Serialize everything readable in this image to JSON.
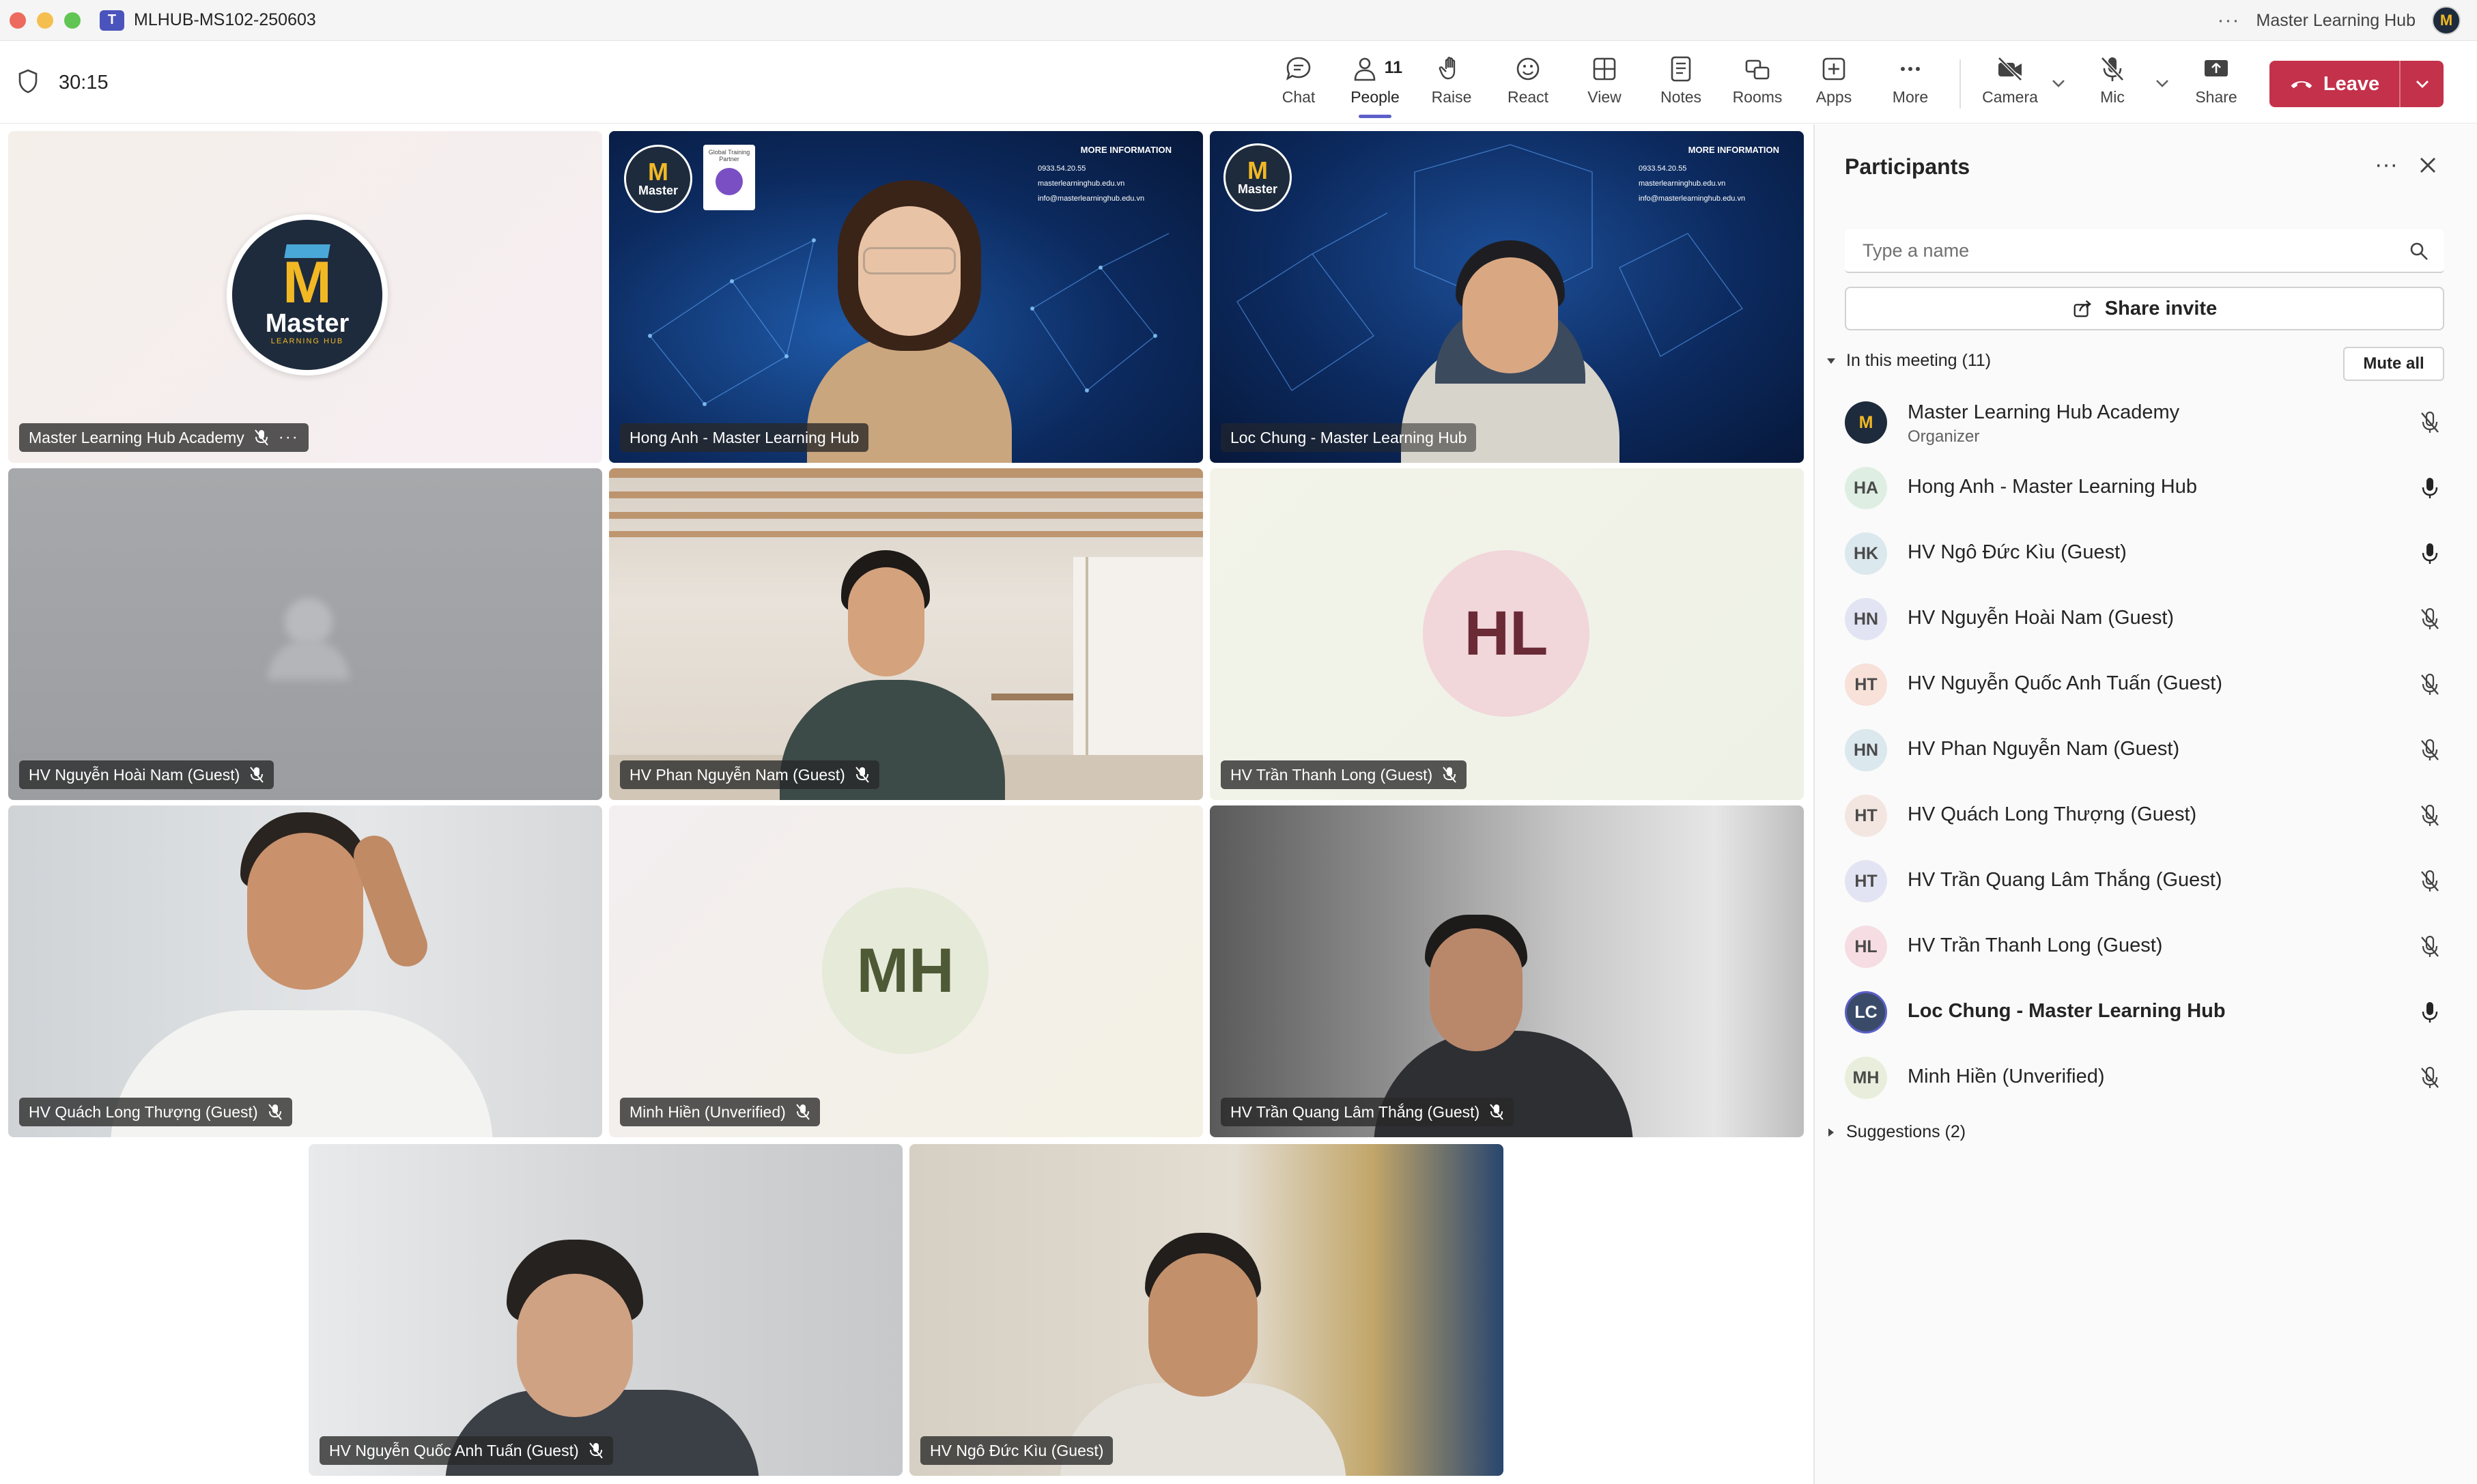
{
  "window": {
    "title": "MLHUB-MS102-250603",
    "account_name": "Master Learning Hub",
    "account_avatar_text": "M"
  },
  "toolbar": {
    "timer": "30:15",
    "buttons": {
      "chat": "Chat",
      "people": "People",
      "people_count": "11",
      "raise": "Raise",
      "react": "React",
      "view": "View",
      "notes": "Notes",
      "rooms": "Rooms",
      "apps": "Apps",
      "more": "More",
      "camera": "Camera",
      "mic": "Mic",
      "share": "Share"
    },
    "leave": "Leave"
  },
  "tiles": [
    {
      "name": "Master Learning Hub Academy",
      "logo_text": "Master",
      "logo_sub": "LEARNING HUB",
      "logo_letter": "M"
    },
    {
      "name": "Hong Anh - Master Learning Hub"
    },
    {
      "name": "Loc Chung - Master Learning Hub"
    },
    {
      "name": "HV Nguyễn Hoài Nam (Guest)"
    },
    {
      "name": "HV Phan Nguyễn Nam (Guest)"
    },
    {
      "name": "HV Trần Thanh Long (Guest)",
      "initials": "HL"
    },
    {
      "name": "HV Quách Long Thượng (Guest)"
    },
    {
      "name": "Minh Hiền (Unverified)",
      "initials": "MH"
    },
    {
      "name": "HV Trần Quang Lâm Thắng (Guest)"
    },
    {
      "name": "HV Nguyễn Quốc Anh Tuấn (Guest)"
    },
    {
      "name": "HV Ngô Đức Kìu (Guest)"
    }
  ],
  "slide_banner": {
    "heading": "MORE INFORMATION",
    "phone": "0933.54.20.55",
    "site": "masterlearninghub.edu.vn",
    "email": "info@masterlearninghub.edu.vn",
    "badge": "Global Training Partner"
  },
  "panel": {
    "title": "Participants",
    "search_placeholder": "Type a name",
    "share_invite": "Share invite",
    "in_meeting": "In this meeting (11)",
    "mute_all": "Mute all",
    "suggestions": "Suggestions (2)",
    "participants": [
      {
        "initials": "M",
        "name": "Master Learning Hub Academy",
        "role": "Organizer",
        "mic": "muted",
        "color": "#1e2b3c"
      },
      {
        "initials": "HA",
        "name": "Hong Anh - Master Learning Hub",
        "mic": "on",
        "color": "#dfeee3"
      },
      {
        "initials": "HK",
        "name": "HV Ngô Đức Kìu (Guest)",
        "mic": "on",
        "color": "#dbe8ee"
      },
      {
        "initials": "HN",
        "name": "HV Nguyễn Hoài Nam (Guest)",
        "mic": "muted",
        "color": "#e3e4f3"
      },
      {
        "initials": "HT",
        "name": "HV Nguyễn Quốc Anh Tuấn (Guest)",
        "mic": "muted",
        "color": "#f7e1d9"
      },
      {
        "initials": "HN",
        "name": "HV Phan Nguyễn Nam (Guest)",
        "mic": "muted",
        "color": "#dbe8ee"
      },
      {
        "initials": "HT",
        "name": "HV Quách Long Thượng (Guest)",
        "mic": "muted",
        "color": "#f3e6e0"
      },
      {
        "initials": "HT",
        "name": "HV Trần Quang Lâm Thắng (Guest)",
        "mic": "muted",
        "color": "#e3e4f3"
      },
      {
        "initials": "HL",
        "name": "HV Trần Thanh Long (Guest)",
        "mic": "muted",
        "color": "#f6dde3"
      },
      {
        "initials": "LC",
        "name": "Loc Chung - Master Learning Hub",
        "mic": "on",
        "color": "#3a4b6a",
        "bold": true
      },
      {
        "initials": "MH",
        "name": "Minh Hiền (Unverified)",
        "mic": "muted",
        "color": "#e9eedc"
      }
    ]
  }
}
